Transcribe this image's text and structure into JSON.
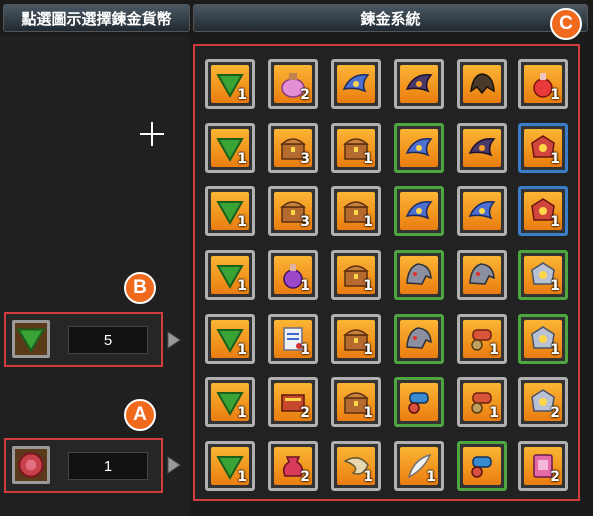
{
  "tabs": {
    "select_currency": "點選圖示選擇鍊金貨幣",
    "alchemy_system": "鍊金系統"
  },
  "badges": {
    "a": "A",
    "b": "B",
    "c": "C"
  },
  "slot_b": {
    "icon": "green-triangle-icon",
    "value": "5"
  },
  "slot_a": {
    "icon": "red-seal-coin-icon",
    "value": "1"
  },
  "colors": {
    "highlight_red": "#d23c3c",
    "badge_orange": "#f06a1e",
    "slot_gold": "#fbb534"
  },
  "grid": {
    "rows": [
      [
        {
          "icon": "green-triangle-icon",
          "qty": "1",
          "frame": "gold"
        },
        {
          "icon": "pink-potion-jar-icon",
          "qty": "2",
          "frame": "gold"
        },
        {
          "icon": "blue-wing-ornament-icon",
          "qty": "",
          "frame": "gold"
        },
        {
          "icon": "dark-wing-ornament-icon",
          "qty": "",
          "frame": "gold"
        },
        {
          "icon": "dark-beast-helmet-icon",
          "qty": "",
          "frame": "gold"
        },
        {
          "icon": "red-potion-bottle-icon",
          "qty": "1",
          "frame": "gold"
        }
      ],
      [
        {
          "icon": "green-triangle-icon",
          "qty": "1",
          "frame": "gold"
        },
        {
          "icon": "treasure-chest-icon",
          "qty": "3",
          "frame": "gold"
        },
        {
          "icon": "treasure-chest-icon",
          "qty": "1",
          "frame": "gold"
        },
        {
          "icon": "blue-wing-ornament-icon",
          "qty": "",
          "frame": "green"
        },
        {
          "icon": "dark-wing-ornament-icon",
          "qty": "",
          "frame": "gold"
        },
        {
          "icon": "red-rune-gem-icon",
          "qty": "1",
          "frame": "blue"
        }
      ],
      [
        {
          "icon": "green-triangle-icon",
          "qty": "1",
          "frame": "gold"
        },
        {
          "icon": "treasure-chest-icon",
          "qty": "3",
          "frame": "gold"
        },
        {
          "icon": "treasure-chest-icon",
          "qty": "1",
          "frame": "gold"
        },
        {
          "icon": "blue-wing-ornament-icon",
          "qty": "",
          "frame": "green"
        },
        {
          "icon": "blue-wing-ornament-icon",
          "qty": "",
          "frame": "gold"
        },
        {
          "icon": "red-rune-gem-icon",
          "qty": "1",
          "frame": "blue"
        }
      ],
      [
        {
          "icon": "green-triangle-icon",
          "qty": "1",
          "frame": "gold"
        },
        {
          "icon": "purple-potion-icon",
          "qty": "1",
          "frame": "gold"
        },
        {
          "icon": "treasure-chest-icon",
          "qty": "1",
          "frame": "gold"
        },
        {
          "icon": "dragon-helmet-icon",
          "qty": "",
          "frame": "green"
        },
        {
          "icon": "dragon-helmet-icon",
          "qty": "",
          "frame": "gold"
        },
        {
          "icon": "silver-rune-gem-icon",
          "qty": "1",
          "frame": "green"
        }
      ],
      [
        {
          "icon": "green-triangle-icon",
          "qty": "1",
          "frame": "gold"
        },
        {
          "icon": "scroll-document-icon",
          "qty": "1",
          "frame": "gold"
        },
        {
          "icon": "treasure-chest-icon",
          "qty": "1",
          "frame": "gold"
        },
        {
          "icon": "dragon-helmet-icon",
          "qty": "",
          "frame": "green"
        },
        {
          "icon": "red-cannon-icon",
          "qty": "1",
          "frame": "gold"
        },
        {
          "icon": "silver-rune-gem-icon",
          "qty": "1",
          "frame": "green"
        }
      ],
      [
        {
          "icon": "green-triangle-icon",
          "qty": "1",
          "frame": "gold"
        },
        {
          "icon": "red-book-icon",
          "qty": "2",
          "frame": "gold"
        },
        {
          "icon": "treasure-chest-icon",
          "qty": "1",
          "frame": "gold"
        },
        {
          "icon": "blue-cannon-icon",
          "qty": "",
          "frame": "green"
        },
        {
          "icon": "red-cannon-icon",
          "qty": "1",
          "frame": "gold"
        },
        {
          "icon": "silver-rune-gem-icon",
          "qty": "2",
          "frame": "gold"
        }
      ],
      [
        {
          "icon": "green-triangle-icon",
          "qty": "1",
          "frame": "gold"
        },
        {
          "icon": "red-potion-vase-icon",
          "qty": "2",
          "frame": "gold"
        },
        {
          "icon": "horn-icon",
          "qty": "1",
          "frame": "gold"
        },
        {
          "icon": "feather-quill-icon",
          "qty": "1",
          "frame": "gold"
        },
        {
          "icon": "blue-cannon-icon",
          "qty": "",
          "frame": "green"
        },
        {
          "icon": "pink-card-icon",
          "qty": "2",
          "frame": "gold"
        }
      ]
    ]
  }
}
